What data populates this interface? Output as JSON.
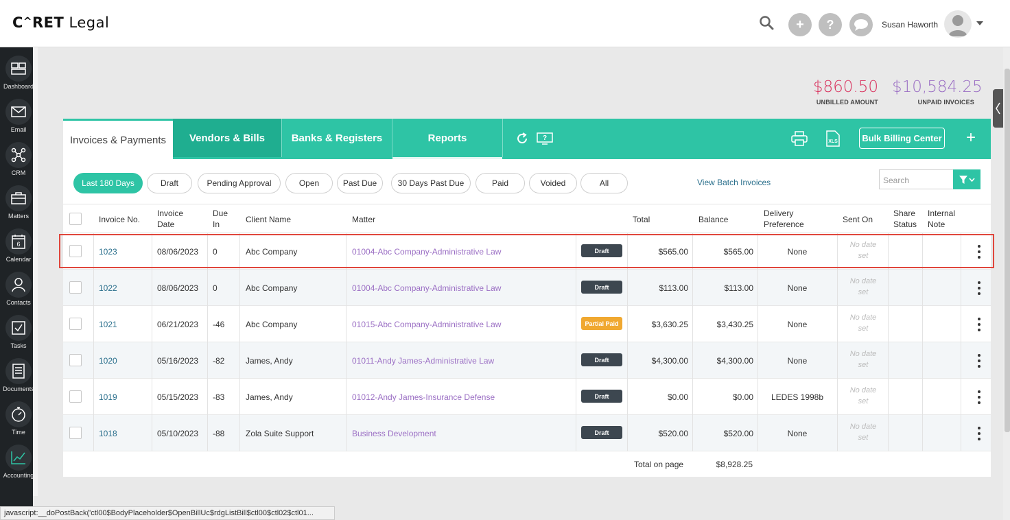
{
  "app": {
    "logo_prefix": "C",
    "logo_a": "^",
    "logo_suffix": "RET",
    "logo_word": "Legal",
    "user_name": "Susan Haworth"
  },
  "header_icons": [
    "search-icon",
    "add-icon",
    "help-icon",
    "chat-icon",
    "avatar",
    "chevron-down-icon"
  ],
  "sidebar": {
    "items": [
      {
        "label": "Dashboard",
        "icon": "dashboard-icon"
      },
      {
        "label": "Email",
        "icon": "envelope-icon"
      },
      {
        "label": "CRM",
        "icon": "network-icon"
      },
      {
        "label": "Matters",
        "icon": "briefcase-icon"
      },
      {
        "label": "Calendar",
        "icon": "calendar-icon",
        "day": "6"
      },
      {
        "label": "Contacts",
        "icon": "contacts-icon"
      },
      {
        "label": "Tasks",
        "icon": "checkbox-icon"
      },
      {
        "label": "Documents",
        "icon": "document-icon"
      },
      {
        "label": "Time",
        "icon": "stopwatch-icon"
      },
      {
        "label": "Accounting",
        "icon": "chart-icon"
      }
    ]
  },
  "summary": {
    "unbilled_value": "$860.50",
    "unbilled_label": "UNBILLED AMOUNT",
    "unbilled_color": "#d9335f",
    "unpaid_value": "$10,584.25",
    "unpaid_label": "UNPAID INVOICES",
    "unpaid_color": "#9b6fc4"
  },
  "tabs": {
    "active": "Invoices & Payments",
    "vendors": "Vendors & Bills",
    "banks": "Banks & Registers",
    "reports": "Reports",
    "bulk_button": "Bulk Billing Center",
    "plus": "+",
    "xls": "XLS",
    "accent": "#2ec4a5"
  },
  "filters": {
    "pills": [
      "Last 180 Days",
      "Draft",
      "Pending Approval",
      "Open",
      "Past Due",
      "30 Days Past Due",
      "Paid",
      "Voided",
      "All"
    ],
    "active": "Last 180 Days",
    "batch_link": "View Batch Invoices",
    "search_placeholder": "Search"
  },
  "table": {
    "headers": {
      "invoice_no": "Invoice No.",
      "invoice_date_1": "Invoice",
      "invoice_date_2": "Date",
      "due_in_1": "Due",
      "due_in_2": "In",
      "client": "Client Name",
      "matter": "Matter",
      "total": "Total",
      "balance": "Balance",
      "delivery_1": "Delivery",
      "delivery_2": "Preference",
      "sent_on": "Sent On",
      "share_1": "Share",
      "share_2": "Status",
      "note_1": "Internal",
      "note_2": "Note"
    },
    "no_date_1": "No date",
    "no_date_2": "set",
    "rows": [
      {
        "invoice": "1023",
        "date": "08/06/2023",
        "due": "0",
        "client": "Abc Company",
        "matter": "01004-Abc Company-Administrative Law",
        "status": "Draft",
        "total": "$565.00",
        "balance": "$565.00",
        "delivery": "None"
      },
      {
        "invoice": "1022",
        "date": "08/06/2023",
        "due": "0",
        "client": "Abc Company",
        "matter": "01004-Abc Company-Administrative Law",
        "status": "Draft",
        "total": "$113.00",
        "balance": "$113.00",
        "delivery": "None"
      },
      {
        "invoice": "1021",
        "date": "06/21/2023",
        "due": "-46",
        "client": "Abc Company",
        "matter": "01015-Abc Company-Administrative Law",
        "status": "Partial Paid",
        "total": "$3,630.25",
        "balance": "$3,430.25",
        "delivery": "None"
      },
      {
        "invoice": "1020",
        "date": "05/16/2023",
        "due": "-82",
        "client": "James, Andy",
        "matter": "01011-Andy James-Administrative Law",
        "status": "Draft",
        "total": "$4,300.00",
        "balance": "$4,300.00",
        "delivery": "None"
      },
      {
        "invoice": "1019",
        "date": "05/15/2023",
        "due": "-83",
        "client": "James, Andy",
        "matter": "01012-Andy James-Insurance Defense",
        "status": "Draft",
        "total": "$0.00",
        "balance": "$0.00",
        "delivery": "LEDES 1998b"
      },
      {
        "invoice": "1018",
        "date": "05/10/2023",
        "due": "-88",
        "client": "Zola Suite Support",
        "matter": "Business Development",
        "status": "Draft",
        "total": "$520.00",
        "balance": "$520.00",
        "delivery": "None"
      }
    ],
    "total_label": "Total on page",
    "total_value": "$8,928.25"
  },
  "statusbar": "javascript:__doPostBack('ctl00$BodyPlaceholder$OpenBillUc$rdgListBill$ctl00$ctl02$ctl01..."
}
